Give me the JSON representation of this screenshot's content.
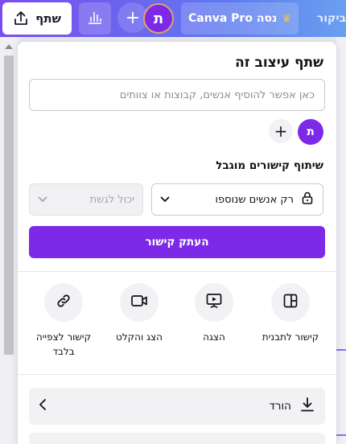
{
  "topbar": {
    "share_label": "שתף",
    "canva_pro_label": "נסה Canva Pro",
    "avatar_letter": "ת",
    "review_label": "ביקור"
  },
  "panel": {
    "title": "שתף עיצוב זה",
    "invite_placeholder": "כאן אפשר להוסיף אנשים, קבוצות או צוותים",
    "member_avatar_letter": "ת",
    "section_title": "שיתוף קישורים מוגבל",
    "access_label": "רק אנשים שנוספו",
    "permission_label": "יכול לגשת",
    "copy_link_label": "העתק קישור",
    "options": [
      {
        "label": "קישור לתבנית",
        "icon": "template-icon"
      },
      {
        "label": "הצגה",
        "icon": "present-icon"
      },
      {
        "label": "הצג והקלט",
        "icon": "video-icon"
      },
      {
        "label": "קישור לצפייה בלבד",
        "icon": "link-icon"
      }
    ],
    "download_label": "הורד"
  },
  "colors": {
    "accent": "#7d2ae8",
    "avatar_ring": "#e0a36b",
    "crown": "#f3c24c"
  }
}
